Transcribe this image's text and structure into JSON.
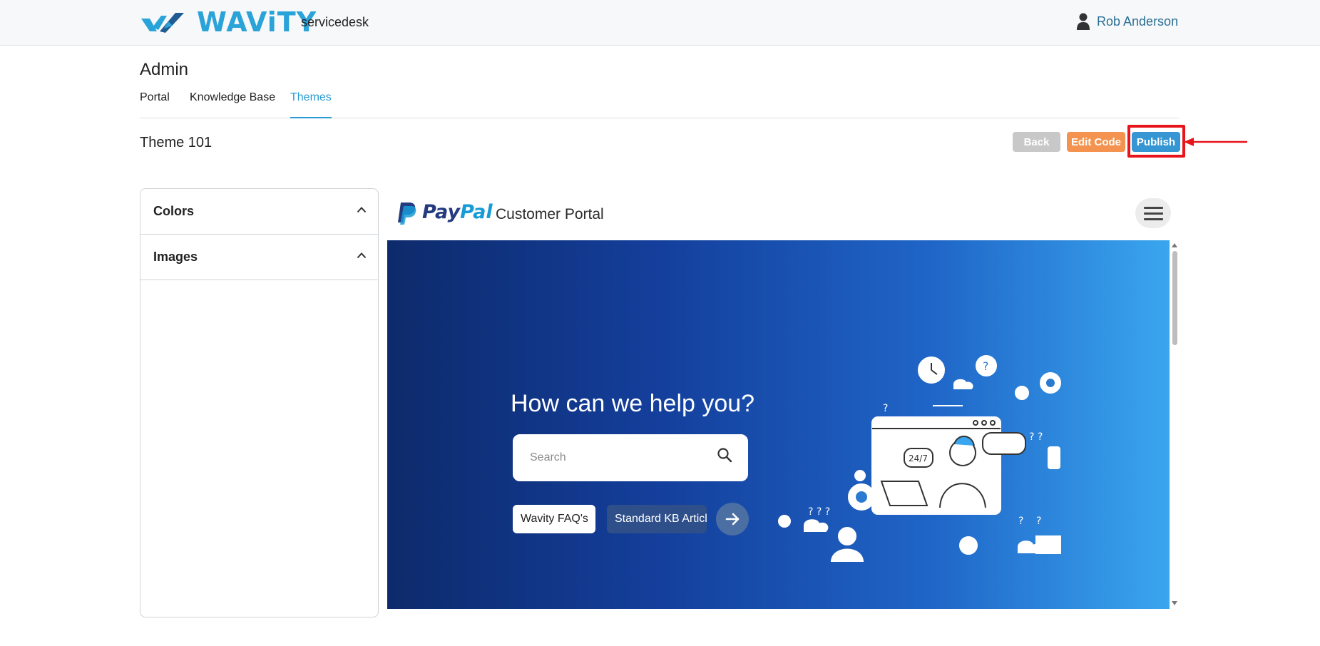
{
  "topbar": {
    "logo_text": "WAViTY",
    "product": "servicedesk",
    "user_name": "Rob Anderson"
  },
  "admin": {
    "title": "Admin",
    "tabs": [
      {
        "label": "Portal",
        "active": false
      },
      {
        "label": "Knowledge Base",
        "active": false
      },
      {
        "label": "Themes",
        "active": true
      }
    ]
  },
  "theme": {
    "title": "Theme 101",
    "buttons": {
      "back": "Back",
      "edit_code": "Edit Code",
      "publish": "Publish"
    }
  },
  "sidebar": {
    "sections": [
      {
        "label": "Colors",
        "icon": "chevron-up-icon"
      },
      {
        "label": "Images",
        "icon": "chevron-up-icon"
      }
    ]
  },
  "preview": {
    "brand_pay": "Pay",
    "brand_pal": "Pal",
    "portal_title": "Customer Portal",
    "hero_title": "How can we help you?",
    "search_placeholder": "Search",
    "chips": [
      "Wavity FAQ's",
      "Standard KB Articles"
    ]
  },
  "colors": {
    "accent": "#2a9ad4",
    "publish": "#3596d3",
    "edit_code": "#f3934f",
    "back": "#c8c8c8",
    "highlight": "#e8141c",
    "hero_start": "#0d2a6b",
    "hero_end": "#3aa6ef"
  }
}
